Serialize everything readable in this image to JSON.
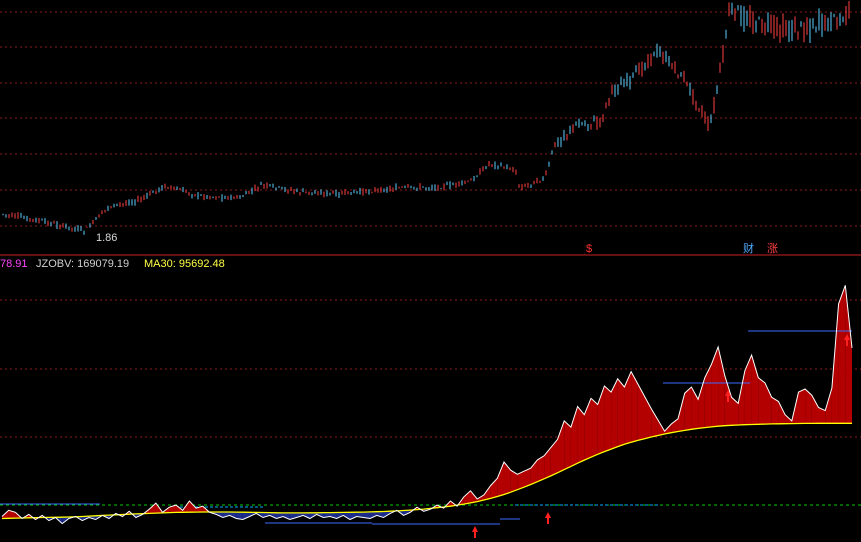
{
  "colors": {
    "background": "#000000",
    "grid": "#8b1a1a",
    "separator": "#cc2222",
    "candle_up": "#ff4040",
    "candle_down": "#5ad0ff",
    "fill_above": "#b30000",
    "fill_below": "#1c2c8a",
    "jzobv_line": "#ffffff",
    "ma30_line": "#ffff00",
    "resistance_line": "#3b6cff",
    "dashed_cyan": "#00aaff",
    "dashed_green": "#00cc00",
    "arrow": "#ff2020",
    "label_magenta": "#ff44ff",
    "label_white": "#d0d0d0",
    "label_yellow": "#ffff44"
  },
  "price_panel": {
    "low_marker": "1.86",
    "event_markers": [
      {
        "text": "$",
        "color": "#ff3030"
      },
      {
        "text": "财",
        "color": "#4fa8ff"
      },
      {
        "text": "涨",
        "color": "#ff4040"
      }
    ]
  },
  "indicator_header": {
    "prefix_value": "78.91",
    "jzobv_label": "JZOBV: 169079.19",
    "ma30_label": "MA30: 95692.48"
  },
  "chart_data": {
    "type": "line",
    "title": "",
    "series": [
      {
        "name": "JZOBV",
        "values": [
          5000,
          11000,
          9000,
          3000,
          7000,
          2000,
          6000,
          1000,
          4000,
          -2000,
          3000,
          5000,
          1000,
          4000,
          2000,
          6000,
          3000,
          8000,
          5000,
          10000,
          4000,
          7000,
          12000,
          18000,
          9000,
          14000,
          16000,
          11000,
          20000,
          13000,
          15000,
          9000,
          7000,
          4000,
          6000,
          3000,
          2000,
          5000,
          8000,
          4000,
          6000,
          3000,
          5000,
          2000,
          4000,
          6000,
          3000,
          7000,
          4000,
          5000,
          3000,
          6000,
          2000,
          5000,
          4000,
          3000,
          6000,
          4000,
          8000,
          11000,
          6000,
          9000,
          14000,
          10000,
          12000,
          16000,
          13000,
          20000,
          15000,
          24000,
          30000,
          22000,
          26000,
          35000,
          42000,
          58000,
          50000,
          46000,
          49000,
          52000,
          60000,
          64000,
          72000,
          80000,
          98000,
          92000,
          112000,
          104000,
          120000,
          114000,
          132000,
          126000,
          139000,
          131000,
          146000,
          134000,
          122000,
          110000,
          99000,
          88000,
          95000,
          100000,
          125000,
          131000,
          119000,
          140000,
          153000,
          170000,
          142000,
          121000,
          115000,
          147000,
          162000,
          140000,
          135000,
          121000,
          117000,
          104000,
          98000,
          126000,
          129000,
          123000,
          111000,
          108000,
          130000,
          212000,
          230000,
          169079
        ]
      },
      {
        "name": "MA30",
        "values": [
          3000,
          3200,
          3400,
          3500,
          3700,
          3900,
          4000,
          4100,
          4200,
          4300,
          4500,
          4700,
          5000,
          5300,
          5600,
          6000,
          6300,
          6600,
          6900,
          7200,
          7500,
          7700,
          8000,
          8300,
          8500,
          8700,
          8900,
          9000,
          9100,
          9200,
          9300,
          9300,
          9300,
          9300,
          9300,
          9200,
          9100,
          9000,
          8900,
          8800,
          8700,
          8600,
          8500,
          8500,
          8500,
          8500,
          8600,
          8600,
          8700,
          8700,
          8800,
          8900,
          9000,
          9100,
          9200,
          9400,
          9600,
          9800,
          10100,
          10400,
          10800,
          11200,
          11700,
          12200,
          12800,
          13500,
          14200,
          15000,
          16000,
          17000,
          18200,
          19500,
          21000,
          22600,
          24400,
          26400,
          28600,
          31000,
          33500,
          36100,
          38800,
          41600,
          44500,
          47500,
          50600,
          53700,
          56800,
          59800,
          62700,
          65500,
          68100,
          70600,
          73000,
          75200,
          77200,
          79000,
          80700,
          82300,
          83800,
          85200,
          86500,
          87700,
          88800,
          89800,
          90700,
          91500,
          92200,
          92800,
          93300,
          93700,
          94000,
          94300,
          94500,
          94700,
          94900,
          95100,
          95200,
          95300,
          95400,
          95500,
          95550,
          95600,
          95620,
          95640,
          95660,
          95675,
          95685,
          95692.48
        ]
      }
    ]
  }
}
